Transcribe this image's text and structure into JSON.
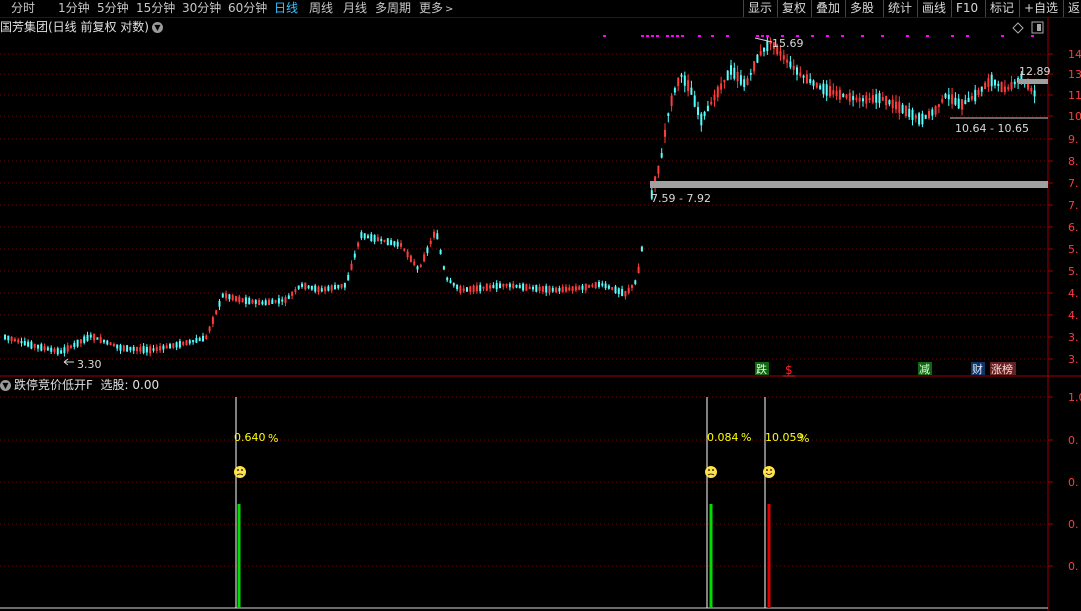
{
  "toolbar": {
    "timeframes": [
      "分时",
      "1分钟",
      "5分钟",
      "15分钟",
      "30分钟",
      "60分钟",
      "日线",
      "周线",
      "月线",
      "多周期",
      "更多"
    ],
    "active_timeframe": "日线",
    "right_buttons": [
      "显示",
      "复权",
      "叠加",
      "多股",
      "统计",
      "画线",
      "F10",
      "标记",
      "+自选",
      "返回"
    ]
  },
  "main_chart": {
    "title": "国芳集团(日线 前复权 对数)",
    "price_axis": [
      "14.",
      "13.",
      "11.",
      "10.",
      "9.",
      "8.",
      "7.",
      "7.",
      "6.",
      "5.",
      "5.",
      "4.",
      "4.",
      "3.",
      "3."
    ],
    "annotations": {
      "high_label": "15.69",
      "low_label": "3.30",
      "band_label_1": "7.59 - 7.92",
      "band_label_2": "10.64 - 10.65",
      "last_price": "12.89"
    },
    "events": [
      "跌",
      "$",
      "减",
      "财",
      "涨榜"
    ]
  },
  "indicator": {
    "name": "跌停竞价低开F",
    "select_label": "选股: 0.00",
    "axis": [
      "1.0",
      "0.",
      "0.",
      "0.",
      "0."
    ],
    "signals": [
      {
        "value": "0.640",
        "unit": "%",
        "color": "green"
      },
      {
        "value": "0.084",
        "unit": "%",
        "color": "green"
      },
      {
        "value": "10.059",
        "unit": "%",
        "color": "red"
      }
    ]
  },
  "colors": {
    "up": "#ff3c3c",
    "down": "#54ffff",
    "gridline": "#7a0000",
    "signal_green": "#00dd00",
    "signal_red": "#dd0000",
    "label_yellow": "#ffff00",
    "magenta": "#ff00ff"
  }
}
